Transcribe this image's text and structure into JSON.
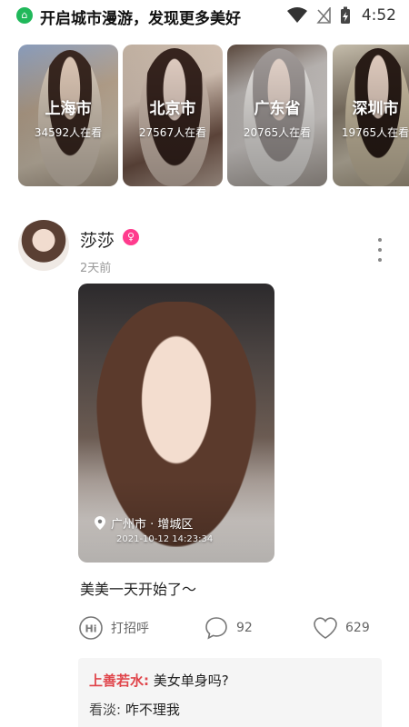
{
  "status_bar": {
    "app_icon": "city-map-icon",
    "title": "开启城市漫游，发现更多美好",
    "time": "4:52",
    "icons": [
      "wifi-icon",
      "no-signal-icon",
      "battery-charging-icon"
    ]
  },
  "cities": [
    {
      "name": "上海市",
      "watching": "34592人在看"
    },
    {
      "name": "北京市",
      "watching": "27567人在看"
    },
    {
      "name": "广东省",
      "watching": "20765人在看"
    },
    {
      "name": "深圳市",
      "watching": "19765人在看"
    }
  ],
  "post": {
    "username": "莎莎",
    "badge_icon": "vip-badge-icon",
    "time_ago": "2天前",
    "photo": {
      "location": "广州市 · 增城区",
      "datetime": "2021-10-12  14:23:34"
    },
    "caption": "美美一天开始了～",
    "actions": {
      "greet_label": "打招呼",
      "greet_icon": "hi-icon",
      "comment_count": "92",
      "comment_icon": "comment-icon",
      "like_count": "629",
      "like_icon": "heart-icon"
    },
    "comments": [
      {
        "author": "上善若水:",
        "text": "美女单身吗?"
      },
      {
        "author": "看淡:",
        "text": "咋不理我"
      }
    ]
  },
  "colors": {
    "accent_pink": "#ff3b8d",
    "comment_author_red": "#e0454b",
    "app_green": "#20b85a"
  }
}
